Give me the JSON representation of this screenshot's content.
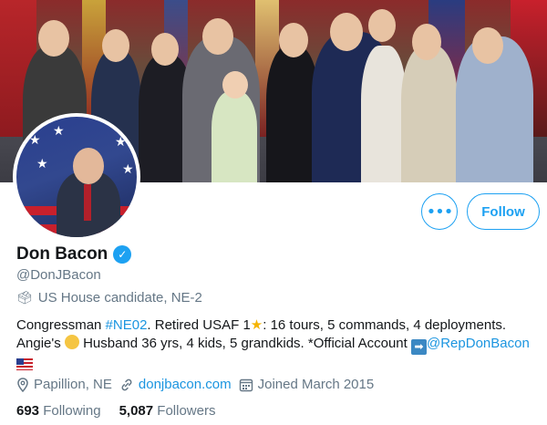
{
  "profile": {
    "name": "Don Bacon",
    "handle": "@DonJBacon",
    "label": "US House candidate, NE-2",
    "bio": {
      "part1": "Congressman ",
      "hashtag": "#NE02",
      "part2": ". Retired USAF 1",
      "part3": ": 16 tours, 5 commands, 4 deployments. Angie's ",
      "part4": " Husband 36 yrs, 4 kids, 5 grandkids. *Official Account ",
      "mention": "@RepDonBacon"
    },
    "location": "Papillion, NE",
    "website": "donjbacon.com",
    "joined": "Joined March 2015",
    "following_count": "693",
    "following_label": "Following",
    "followers_count": "5,087",
    "followers_label": "Followers"
  },
  "actions": {
    "more_label": "•••",
    "follow_label": "Follow"
  },
  "icons": {
    "verified": "verified-badge-icon",
    "label": "ballot-box-icon",
    "location": "location-pin-icon",
    "link": "link-icon",
    "calendar": "calendar-icon",
    "star_emoji": "star-emoji-icon",
    "person_emoji": "person-emoji-icon",
    "arrow_emoji": "arrow-right-emoji-icon",
    "flag_emoji": "us-flag-emoji-icon"
  },
  "colors": {
    "accent": "#1da1f2",
    "link": "#1b95e0",
    "muted": "#657786",
    "text": "#14171a"
  }
}
